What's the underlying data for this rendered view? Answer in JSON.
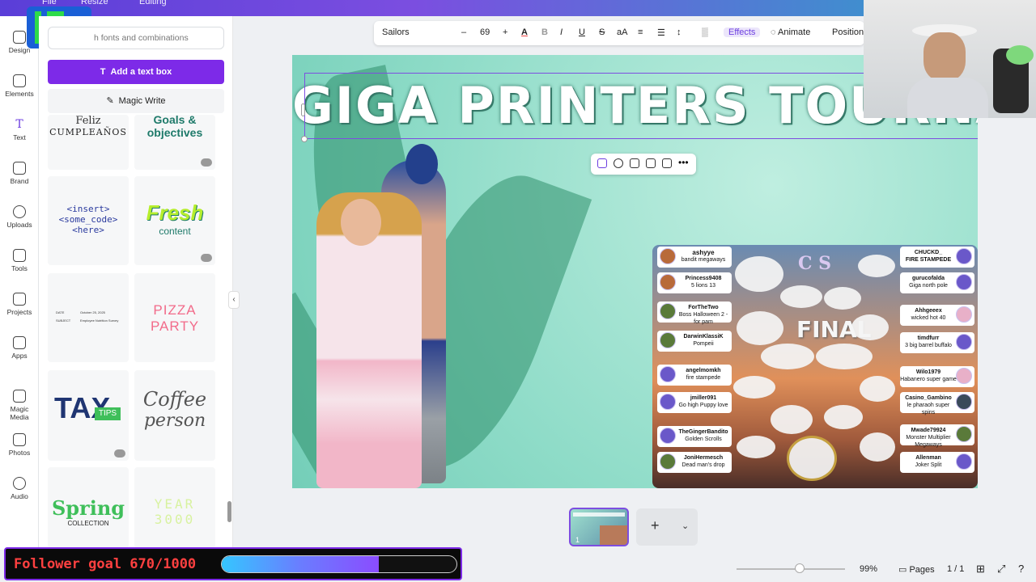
{
  "topbar": {
    "file": "File",
    "resize": "Resize",
    "editing": "Editing"
  },
  "logo": {
    "number": "5"
  },
  "rail": [
    {
      "label": "Design"
    },
    {
      "label": "Elements"
    },
    {
      "label": "Text"
    },
    {
      "label": "Brand"
    },
    {
      "label": "Uploads"
    },
    {
      "label": "Tools"
    },
    {
      "label": "Projects"
    },
    {
      "label": "Apps"
    },
    {
      "label": "Magic Media"
    },
    {
      "label": "Photos"
    },
    {
      "label": "Audio"
    }
  ],
  "panel": {
    "search_placeholder": "h fonts and combinations",
    "add_text_label": "Add a text box",
    "magic_write_label": "Magic Write",
    "tiles": [
      {
        "t1": "Feliz",
        "t2": "CUMPLEAÑOS"
      },
      {
        "t1": "Goals &",
        "t2": "objectives"
      },
      {
        "t1": "<insert>",
        "t2": "<some_code>",
        "t3": "<here>"
      },
      {
        "t1": "Fresh",
        "t2": "content"
      },
      {
        "t1": "DATE",
        "t2": "October 25, 2025",
        "t3": "SUBJECT",
        "t4": "Employee Nutrition Survey"
      },
      {
        "t1": "PIZZA",
        "t2": "PARTY"
      },
      {
        "t1": "TAX",
        "t2": "TIPS"
      },
      {
        "t1": "Coffee",
        "t2": "person"
      },
      {
        "t1": "Spring",
        "t2": "COLLECTION"
      },
      {
        "t1": "YEAR",
        "t2": "3000"
      }
    ]
  },
  "toolbar": {
    "font": "Sailors",
    "size": "69",
    "minus": "–",
    "plus": "+",
    "effects": "Effects",
    "animate": "Animate",
    "position": "Position"
  },
  "canvas": {
    "title": "GIGA PRINTERS TOURNAMENT",
    "final": "FINAL",
    "cs": "C S",
    "left_players": [
      {
        "name": "ashyye",
        "game": "bandit megaways"
      },
      {
        "name": "Princess9408",
        "game": "5 lions 13"
      },
      {
        "name": "ForTheTwo",
        "game": "Boss Halloween 2 - for pam"
      },
      {
        "name": "DarwinKlassiK",
        "game": "Pompeii"
      },
      {
        "name": "angelmomkh",
        "game": "fire stampede"
      },
      {
        "name": "jmiller091",
        "game": "Go high Puppy love"
      },
      {
        "name": "TheGingerBandito",
        "game": "Golden Scrolls"
      },
      {
        "name": "JoniHermesch",
        "game": "Dead man's drop"
      }
    ],
    "right_players": [
      {
        "name": "CHUCKD_",
        "game": "FIRE STAMPEDE"
      },
      {
        "name": "gurucofalda",
        "game": "Giga north pole"
      },
      {
        "name": "Ahhgeeex",
        "game": "wicked hot 40"
      },
      {
        "name": "timdfurr",
        "game": "3 big barrel buffalo"
      },
      {
        "name": "Wilo1979",
        "game": "Habanero super game"
      },
      {
        "name": "Casino_Gambino",
        "game": "le pharaoh super spins"
      },
      {
        "name": "Mwade79924",
        "game": "Monster Multiplier Megaways"
      },
      {
        "name": "Allenman",
        "game": "Joker Split"
      }
    ]
  },
  "bottom": {
    "zoom": "99%",
    "pages": "Pages",
    "page_count": "1 / 1",
    "add": "+",
    "thumb_num": "1"
  },
  "goal": {
    "text": "Follower goal 670/1000",
    "progress": 0.67
  }
}
